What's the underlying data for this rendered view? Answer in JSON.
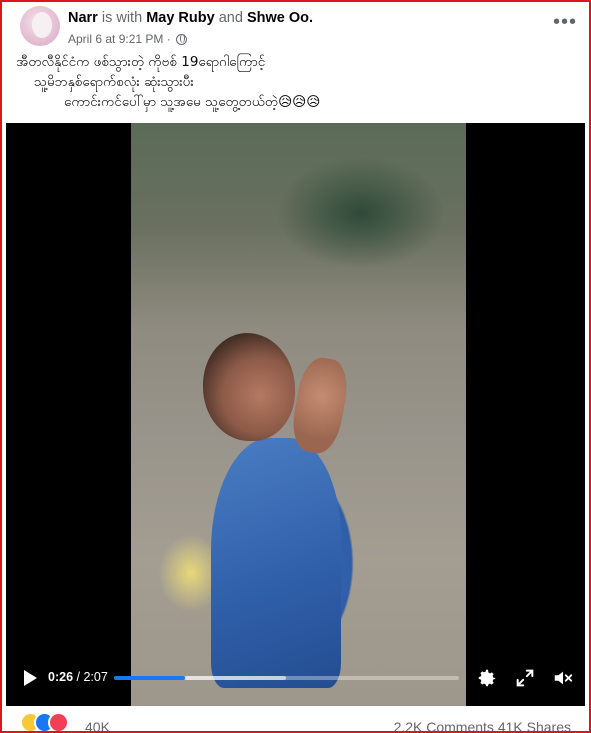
{
  "post": {
    "author": "Narr",
    "with_text": "is with",
    "tagged_1": "May Ruby",
    "and_text": "and",
    "tagged_2": "Shwe Oo.",
    "date": "April 6 at 9:21 PM",
    "dot": "·",
    "privacy_icon": "globe-icon",
    "more_icon": "more-options-icon",
    "caption": [
      "အီတလီနိုင်ငံက ဖစ်သွားတဲ့  ကိုဗစ် 19ရောဂါကြောင့်",
      "သူ့မိဘနှစ်ရောက်စလုံး ဆုံးသွားပီး",
      "ကောင်းကင်ပေါ်မှာ သူ့အမေ သူ့တွေ့တယ်တဲ့😥😥😥"
    ]
  },
  "video": {
    "current_time": "0:26",
    "time_sep": " / ",
    "duration": "2:07",
    "progress": 0.2047,
    "buffered": 0.5,
    "icons": [
      "play-icon",
      "settings-icon",
      "fullscreen-icon",
      "mute-icon"
    ]
  },
  "footer": {
    "reaction_icons": [
      "haha-icon",
      "like-icon",
      "love-icon"
    ],
    "reaction_count": "40K",
    "comments": "2.2K Comments",
    "shares": "41K Shares"
  },
  "colors": {
    "accent": "#1877f2",
    "border": "#e0141b",
    "muted": "#65676b",
    "love": "#f33e58",
    "haha": "#f7c83a"
  }
}
